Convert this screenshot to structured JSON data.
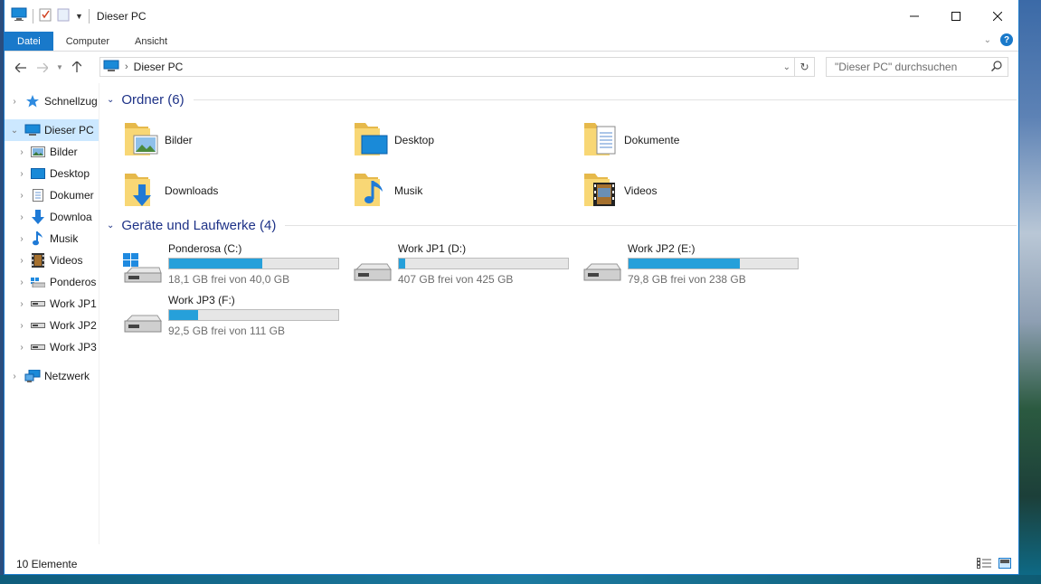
{
  "window": {
    "title": "Dieser PC"
  },
  "ribbon": {
    "tabs": [
      "Datei",
      "Computer",
      "Ansicht"
    ],
    "help": "?"
  },
  "address": {
    "crumb": "Dieser PC"
  },
  "search": {
    "placeholder": "\"Dieser PC\" durchsuchen"
  },
  "nav": {
    "quick_access": "Schnellzug",
    "this_pc": "Dieser PC",
    "items": [
      "Bilder",
      "Desktop",
      "Dokumer",
      "Downloa",
      "Musik",
      "Videos",
      "Ponderos",
      "Work JP1",
      "Work JP2",
      "Work JP3"
    ],
    "network": "Netzwerk"
  },
  "folders": {
    "header": "Ordner (6)",
    "items": [
      {
        "label": "Bilder",
        "icon": "pictures-folder-icon"
      },
      {
        "label": "Desktop",
        "icon": "desktop-folder-icon"
      },
      {
        "label": "Dokumente",
        "icon": "documents-folder-icon"
      },
      {
        "label": "Downloads",
        "icon": "downloads-folder-icon"
      },
      {
        "label": "Musik",
        "icon": "music-folder-icon"
      },
      {
        "label": "Videos",
        "icon": "videos-folder-icon"
      }
    ]
  },
  "drives": {
    "header": "Geräte und Laufwerke (4)",
    "items": [
      {
        "name": "Ponderosa (C:)",
        "free": "18,1 GB frei von 40,0 GB",
        "used_fraction": 0.55
      },
      {
        "name": "Work JP1 (D:)",
        "free": "407 GB frei von 425 GB",
        "used_fraction": 0.04
      },
      {
        "name": "Work JP2 (E:)",
        "free": "79,8 GB frei von 238 GB",
        "used_fraction": 0.66
      },
      {
        "name": "Work JP3 (F:)",
        "free": "92,5 GB frei von 111 GB",
        "used_fraction": 0.17
      }
    ]
  },
  "status": {
    "count": "10 Elemente"
  },
  "colors": {
    "accent": "#1979ca",
    "bar_fill": "#26a0da",
    "header_text": "#1e3287"
  }
}
